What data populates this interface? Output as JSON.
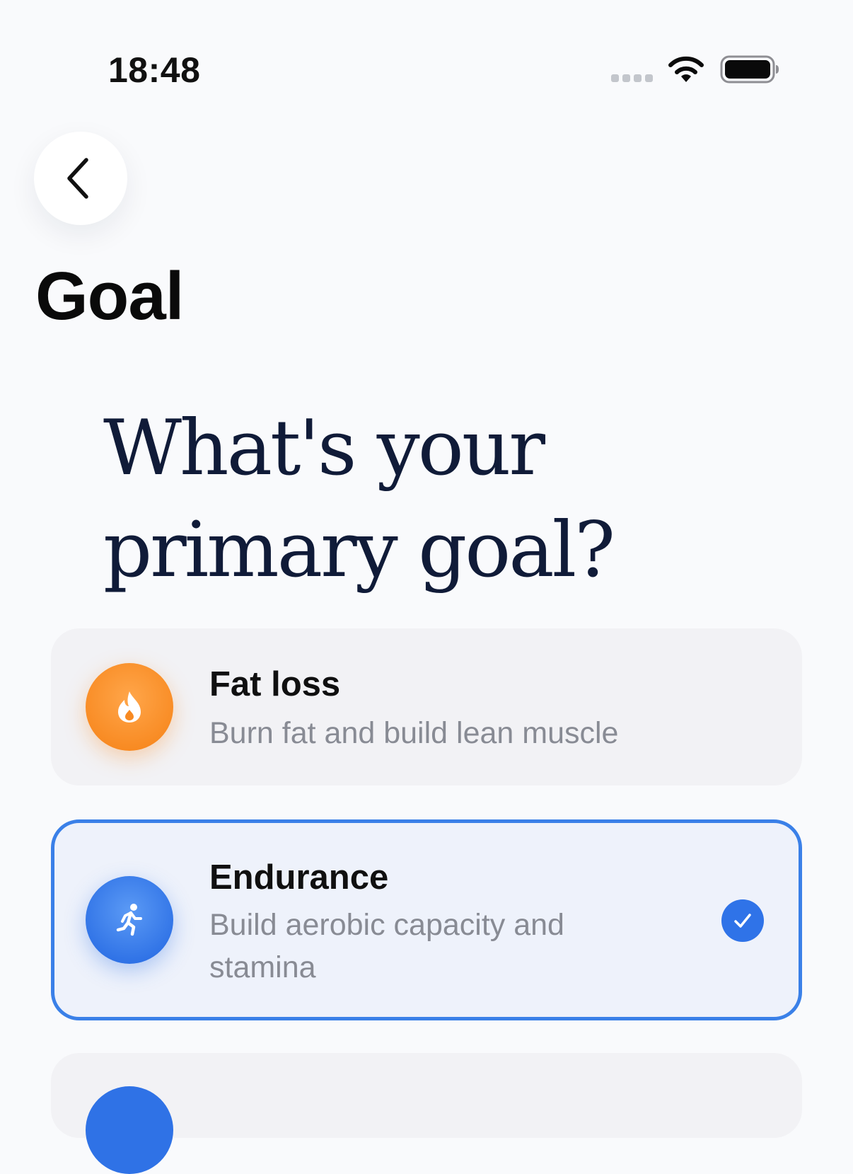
{
  "status_bar": {
    "time": "18:48",
    "signal_icon": "signal-dots-icon",
    "wifi_icon": "wifi-icon",
    "battery_icon": "battery-icon"
  },
  "nav": {
    "back_icon": "chevron-left-icon",
    "title": "Goal"
  },
  "question": {
    "line1": "What's your",
    "line2": "primary goal?"
  },
  "options": [
    {
      "title": "Fat loss",
      "description": "Burn fat and build lean muscle",
      "icon": "flame-icon",
      "icon_color": "#f88a22",
      "selected": false
    },
    {
      "title": "Endurance",
      "description": "Build aerobic capacity and stamina",
      "icon": "running-person-icon",
      "icon_color": "#2f72e6",
      "selected": true
    }
  ],
  "colors": {
    "accent": "#3a80e8",
    "selected_bg": "#eef2fb",
    "card_bg": "#f2f2f5",
    "heading": "#101b38",
    "muted_text": "#888b94"
  }
}
